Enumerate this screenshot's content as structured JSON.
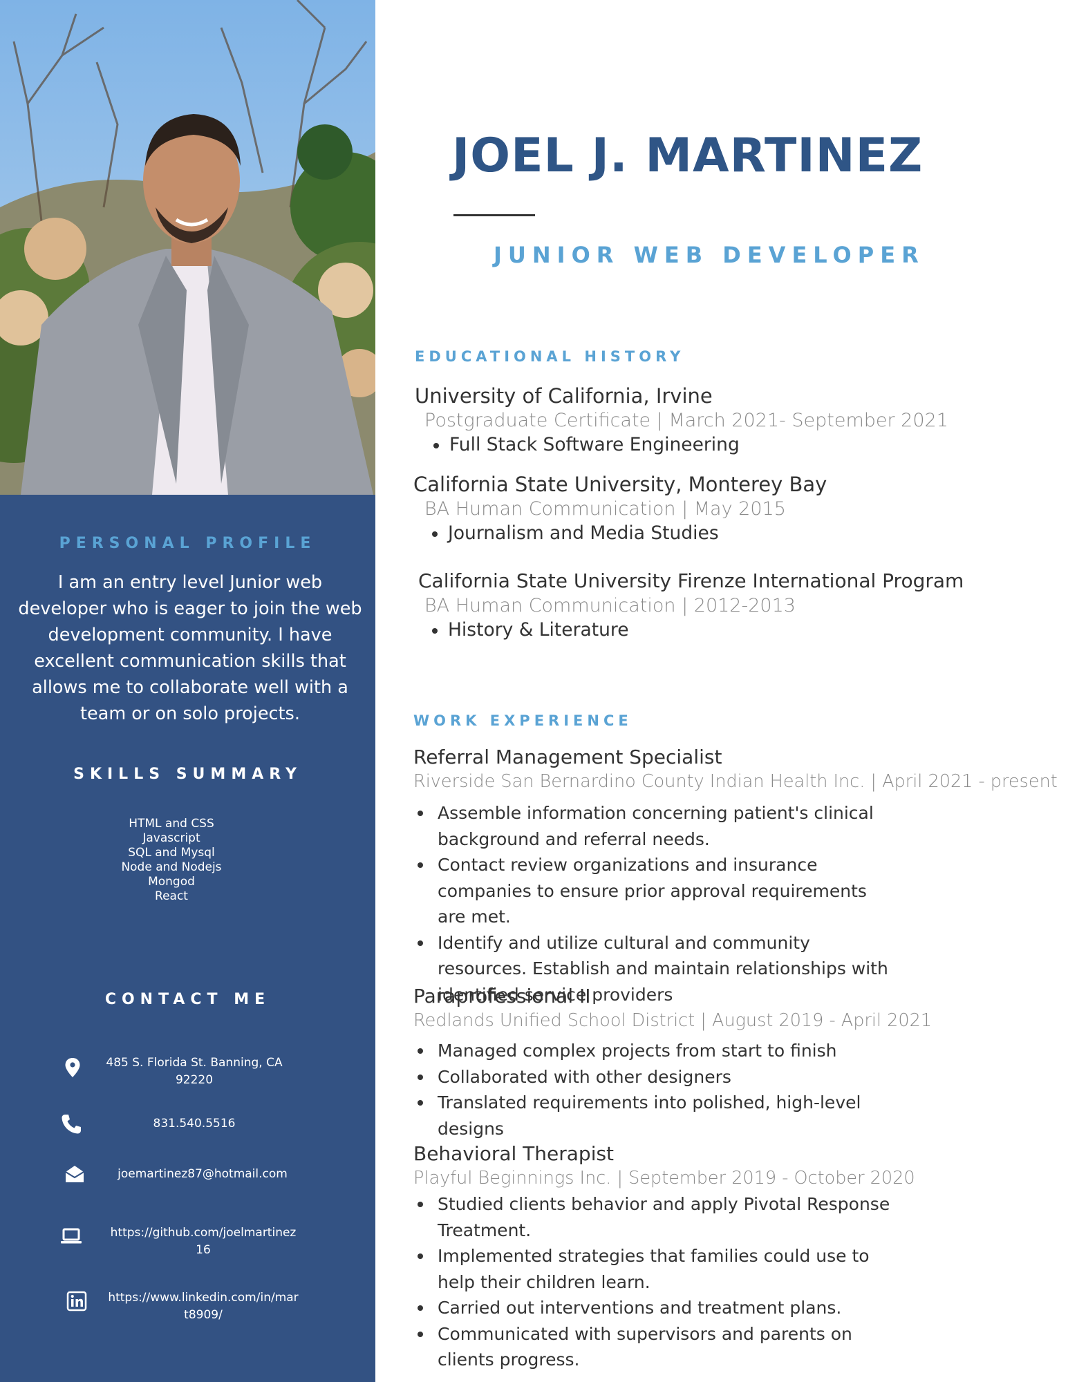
{
  "header": {
    "name": "JOEL J. MARTINEZ",
    "title": "JUNIOR WEB DEVELOPER"
  },
  "sidebar": {
    "profile_heading": "PERSONAL PROFILE",
    "profile_text": "I am an entry level Junior web developer who is eager to join the web development community. I have excellent communication skills that allows me to collaborate well with a team or on solo projects.",
    "skills_heading": "SKILLS SUMMARY",
    "skills": [
      "HTML and CSS",
      "Javascript",
      "SQL and Mysql",
      "Node and Nodejs",
      "Mongod",
      "React"
    ],
    "contact_heading": "CONTACT ME",
    "contacts": [
      {
        "icon": "location-pin-icon",
        "text": "485 S. Florida St. Banning, CA 92220"
      },
      {
        "icon": "phone-icon",
        "text": "831.540.5516"
      },
      {
        "icon": "envelope-icon",
        "text": "joemartinez87@hotmail.com"
      },
      {
        "icon": "laptop-icon",
        "text": "https://github.com/joelmartinez16"
      },
      {
        "icon": "linkedin-icon",
        "text": "https://www.linkedin.com/in/mart8909/"
      }
    ]
  },
  "education": {
    "heading": "EDUCATIONAL HISTORY",
    "entries": [
      {
        "school": "University of California, Irvine",
        "detail": "Postgraduate Certificate | March 2021- September 2021",
        "bullets": [
          "Full Stack Software Engineering"
        ]
      },
      {
        "school": "California State University, Monterey Bay",
        "detail": "BA Human Communication | May 2015",
        "bullets": [
          "Journalism and Media Studies"
        ]
      },
      {
        "school": "California State University Firenze International Program",
        "detail": "BA Human Communication | 2012-2013",
        "bullets": [
          "History & Literature"
        ]
      }
    ]
  },
  "work": {
    "heading": "WORK EXPERIENCE",
    "jobs": [
      {
        "title": "Referral Management Specialist",
        "detail": "Riverside San Bernardino County Indian Health Inc. | April 2021 - present",
        "bullets": [
          "Assemble information concerning patient's clinical background and referral needs.",
          "Contact review organizations and insurance companies to ensure prior approval requirements are met.",
          "Identify and utilize cultural and community resources. Establish and maintain relationships with identified service providers"
        ]
      },
      {
        "title": "Paraprofessional II",
        "detail": "Redlands Unified School District | August 2019 - April 2021",
        "bullets": [
          "Managed complex projects from start to finish",
          "Collaborated with other designers",
          "Translated requirements into polished, high-level designs"
        ]
      },
      {
        "title": "Behavioral Therapist",
        "detail": "Playful Beginnings Inc. | September  2019 - October 2020",
        "bullets": [
          "Studied clients behavior and apply Pivotal Response Treatment.",
          "Implemented strategies that families could use to help their children learn.",
          "Carried out interventions and treatment plans.",
          "Communicated with supervisors and parents on clients progress."
        ]
      }
    ]
  },
  "colors": {
    "sidebar": "#335283",
    "accent": "#5aa3d4",
    "name": "#2f5586",
    "text": "#333333",
    "muted": "#8a8a8a"
  }
}
